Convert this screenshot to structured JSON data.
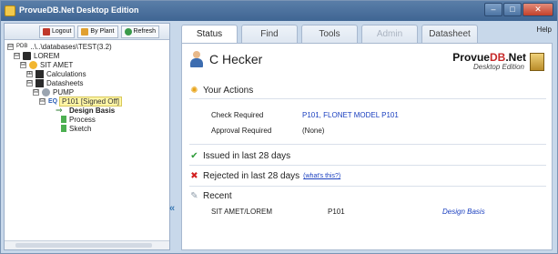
{
  "window": {
    "title": "ProvueDB.Net Desktop Edition",
    "buttons": [
      "–",
      "□",
      "✕"
    ]
  },
  "toolbar": {
    "logout_label": "Logout",
    "by_plant_label": "By Plant",
    "refresh_label": "Refresh"
  },
  "tree": [
    {
      "label": "..\\..\\databases\\TEST(3.2)",
      "prefix": "PDB",
      "expander": "⊟",
      "icon": "database-icon",
      "style": "normal"
    },
    {
      "label": "LOREM",
      "expander": "⊟",
      "icon": "plant-icon",
      "style": "normal"
    },
    {
      "label": "SIT AMET",
      "expander": "⊟",
      "icon": "unit-icon",
      "style": "normal"
    },
    {
      "label": "Calculations",
      "expander": "⊞",
      "icon": "book-icon",
      "style": "normal"
    },
    {
      "label": "Datasheets",
      "expander": "⊟",
      "icon": "book-icon",
      "style": "normal"
    },
    {
      "label": "PUMP",
      "expander": "⊟",
      "icon": "pump-icon",
      "style": "normal"
    },
    {
      "label": "P101 [Signed Off]",
      "expander": "⊟",
      "icon": "equipment-icon",
      "style": "signed"
    },
    {
      "label": "Design Basis",
      "expander": "",
      "icon": "arrow-icon",
      "style": "bold"
    },
    {
      "label": "Process",
      "expander": "",
      "icon": "sheet-icon",
      "style": "normal"
    },
    {
      "label": "Sketch",
      "expander": "",
      "icon": "sheet-icon",
      "style": "normal"
    }
  ],
  "tabs": [
    {
      "label": "Status",
      "state": "active"
    },
    {
      "label": "Find",
      "state": "normal"
    },
    {
      "label": "Tools",
      "state": "normal"
    },
    {
      "label": "Admin",
      "state": "disabled"
    },
    {
      "label": "Datasheet",
      "state": "normal"
    }
  ],
  "help_label": "Help",
  "user": {
    "name": "C Hecker"
  },
  "logo": {
    "prefix": "Provue",
    "db": "DB",
    "suffix": ".Net",
    "subtitle": "Desktop Edition"
  },
  "your_actions": {
    "title": "Your Actions",
    "rows": [
      {
        "label": "Check Required",
        "value": "P101, FLONET MODEL P101"
      },
      {
        "label": "Approval Required",
        "value": "(None)"
      }
    ]
  },
  "issued": {
    "title": "Issued in last 28 days"
  },
  "rejected": {
    "title": "Rejected in last 28 days",
    "link": "(what's this?)"
  },
  "recent": {
    "title": "Recent",
    "rows": [
      {
        "location": "SIT AMET/LOREM",
        "item": "P101",
        "sheet": "Design Basis"
      }
    ]
  },
  "collapse_glyph": "«",
  "colors": {
    "link": "#1a3fbf",
    "title_bar": "#3f6593",
    "signed_highlight": "#fff6a6",
    "check": "#2e9b3a",
    "cross": "#d32020"
  }
}
